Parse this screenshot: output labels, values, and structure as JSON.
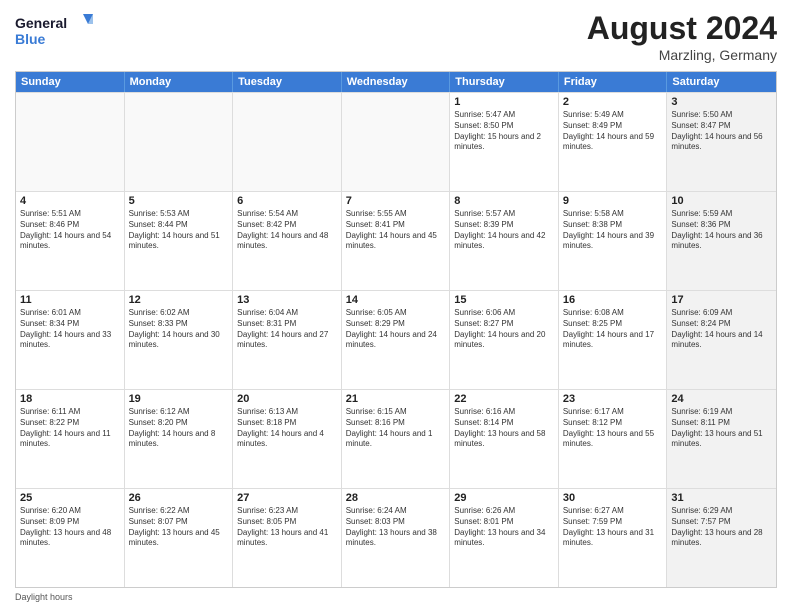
{
  "header": {
    "logo_general": "General",
    "logo_blue": "Blue",
    "month_year": "August 2024",
    "location": "Marzling, Germany"
  },
  "days_of_week": [
    "Sunday",
    "Monday",
    "Tuesday",
    "Wednesday",
    "Thursday",
    "Friday",
    "Saturday"
  ],
  "rows": [
    [
      {
        "day": "",
        "empty": true
      },
      {
        "day": "",
        "empty": true
      },
      {
        "day": "",
        "empty": true
      },
      {
        "day": "",
        "empty": true
      },
      {
        "day": "1",
        "sunrise": "Sunrise: 5:47 AM",
        "sunset": "Sunset: 8:50 PM",
        "daylight": "Daylight: 15 hours and 2 minutes."
      },
      {
        "day": "2",
        "sunrise": "Sunrise: 5:49 AM",
        "sunset": "Sunset: 8:49 PM",
        "daylight": "Daylight: 14 hours and 59 minutes."
      },
      {
        "day": "3",
        "sunrise": "Sunrise: 5:50 AM",
        "sunset": "Sunset: 8:47 PM",
        "daylight": "Daylight: 14 hours and 56 minutes.",
        "shaded": true
      }
    ],
    [
      {
        "day": "4",
        "sunrise": "Sunrise: 5:51 AM",
        "sunset": "Sunset: 8:46 PM",
        "daylight": "Daylight: 14 hours and 54 minutes."
      },
      {
        "day": "5",
        "sunrise": "Sunrise: 5:53 AM",
        "sunset": "Sunset: 8:44 PM",
        "daylight": "Daylight: 14 hours and 51 minutes."
      },
      {
        "day": "6",
        "sunrise": "Sunrise: 5:54 AM",
        "sunset": "Sunset: 8:42 PM",
        "daylight": "Daylight: 14 hours and 48 minutes."
      },
      {
        "day": "7",
        "sunrise": "Sunrise: 5:55 AM",
        "sunset": "Sunset: 8:41 PM",
        "daylight": "Daylight: 14 hours and 45 minutes."
      },
      {
        "day": "8",
        "sunrise": "Sunrise: 5:57 AM",
        "sunset": "Sunset: 8:39 PM",
        "daylight": "Daylight: 14 hours and 42 minutes."
      },
      {
        "day": "9",
        "sunrise": "Sunrise: 5:58 AM",
        "sunset": "Sunset: 8:38 PM",
        "daylight": "Daylight: 14 hours and 39 minutes."
      },
      {
        "day": "10",
        "sunrise": "Sunrise: 5:59 AM",
        "sunset": "Sunset: 8:36 PM",
        "daylight": "Daylight: 14 hours and 36 minutes.",
        "shaded": true
      }
    ],
    [
      {
        "day": "11",
        "sunrise": "Sunrise: 6:01 AM",
        "sunset": "Sunset: 8:34 PM",
        "daylight": "Daylight: 14 hours and 33 minutes."
      },
      {
        "day": "12",
        "sunrise": "Sunrise: 6:02 AM",
        "sunset": "Sunset: 8:33 PM",
        "daylight": "Daylight: 14 hours and 30 minutes."
      },
      {
        "day": "13",
        "sunrise": "Sunrise: 6:04 AM",
        "sunset": "Sunset: 8:31 PM",
        "daylight": "Daylight: 14 hours and 27 minutes."
      },
      {
        "day": "14",
        "sunrise": "Sunrise: 6:05 AM",
        "sunset": "Sunset: 8:29 PM",
        "daylight": "Daylight: 14 hours and 24 minutes."
      },
      {
        "day": "15",
        "sunrise": "Sunrise: 6:06 AM",
        "sunset": "Sunset: 8:27 PM",
        "daylight": "Daylight: 14 hours and 20 minutes."
      },
      {
        "day": "16",
        "sunrise": "Sunrise: 6:08 AM",
        "sunset": "Sunset: 8:25 PM",
        "daylight": "Daylight: 14 hours and 17 minutes."
      },
      {
        "day": "17",
        "sunrise": "Sunrise: 6:09 AM",
        "sunset": "Sunset: 8:24 PM",
        "daylight": "Daylight: 14 hours and 14 minutes.",
        "shaded": true
      }
    ],
    [
      {
        "day": "18",
        "sunrise": "Sunrise: 6:11 AM",
        "sunset": "Sunset: 8:22 PM",
        "daylight": "Daylight: 14 hours and 11 minutes."
      },
      {
        "day": "19",
        "sunrise": "Sunrise: 6:12 AM",
        "sunset": "Sunset: 8:20 PM",
        "daylight": "Daylight: 14 hours and 8 minutes."
      },
      {
        "day": "20",
        "sunrise": "Sunrise: 6:13 AM",
        "sunset": "Sunset: 8:18 PM",
        "daylight": "Daylight: 14 hours and 4 minutes."
      },
      {
        "day": "21",
        "sunrise": "Sunrise: 6:15 AM",
        "sunset": "Sunset: 8:16 PM",
        "daylight": "Daylight: 14 hours and 1 minute."
      },
      {
        "day": "22",
        "sunrise": "Sunrise: 6:16 AM",
        "sunset": "Sunset: 8:14 PM",
        "daylight": "Daylight: 13 hours and 58 minutes."
      },
      {
        "day": "23",
        "sunrise": "Sunrise: 6:17 AM",
        "sunset": "Sunset: 8:12 PM",
        "daylight": "Daylight: 13 hours and 55 minutes."
      },
      {
        "day": "24",
        "sunrise": "Sunrise: 6:19 AM",
        "sunset": "Sunset: 8:11 PM",
        "daylight": "Daylight: 13 hours and 51 minutes.",
        "shaded": true
      }
    ],
    [
      {
        "day": "25",
        "sunrise": "Sunrise: 6:20 AM",
        "sunset": "Sunset: 8:09 PM",
        "daylight": "Daylight: 13 hours and 48 minutes."
      },
      {
        "day": "26",
        "sunrise": "Sunrise: 6:22 AM",
        "sunset": "Sunset: 8:07 PM",
        "daylight": "Daylight: 13 hours and 45 minutes."
      },
      {
        "day": "27",
        "sunrise": "Sunrise: 6:23 AM",
        "sunset": "Sunset: 8:05 PM",
        "daylight": "Daylight: 13 hours and 41 minutes."
      },
      {
        "day": "28",
        "sunrise": "Sunrise: 6:24 AM",
        "sunset": "Sunset: 8:03 PM",
        "daylight": "Daylight: 13 hours and 38 minutes."
      },
      {
        "day": "29",
        "sunrise": "Sunrise: 6:26 AM",
        "sunset": "Sunset: 8:01 PM",
        "daylight": "Daylight: 13 hours and 34 minutes."
      },
      {
        "day": "30",
        "sunrise": "Sunrise: 6:27 AM",
        "sunset": "Sunset: 7:59 PM",
        "daylight": "Daylight: 13 hours and 31 minutes."
      },
      {
        "day": "31",
        "sunrise": "Sunrise: 6:29 AM",
        "sunset": "Sunset: 7:57 PM",
        "daylight": "Daylight: 13 hours and 28 minutes.",
        "shaded": true
      }
    ]
  ],
  "footer": {
    "note": "Daylight hours"
  }
}
